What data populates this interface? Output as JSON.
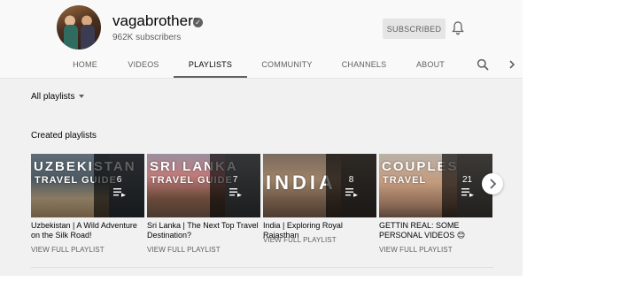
{
  "channel": {
    "name": "vagabrothers",
    "subscribers": "962K subscribers",
    "subscribe_label": "SUBSCRIBED"
  },
  "tabs": [
    {
      "label": "HOME"
    },
    {
      "label": "VIDEOS"
    },
    {
      "label": "PLAYLISTS"
    },
    {
      "label": "COMMUNITY"
    },
    {
      "label": "CHANNELS"
    },
    {
      "label": "ABOUT"
    }
  ],
  "active_tab": "PLAYLISTS",
  "sort": {
    "label": "All playlists"
  },
  "section": {
    "title": "Created playlists"
  },
  "playlists": [
    {
      "thumb_title": "UZBEKISTAN",
      "thumb_subtitle": "TRAVEL GUIDE",
      "count": "6",
      "title": "Uzbekistan | A Wild Adventure on the Silk Road!",
      "action": "VIEW FULL PLAYLIST"
    },
    {
      "thumb_title": "SRI LANKA",
      "thumb_subtitle": "TRAVEL GUIDE",
      "count": "7",
      "title": "Sri Lanka | The Next Top Travel Destination?",
      "action": "VIEW FULL PLAYLIST"
    },
    {
      "thumb_title": "INDIA",
      "thumb_subtitle": "",
      "count": "8",
      "title": "India | Exploring Royal Rajasthan",
      "action": "VIEW FULL PLAYLIST"
    },
    {
      "thumb_title": "COUPLES",
      "thumb_subtitle": "TRAVEL",
      "count": "21",
      "title": "GETTIN REAL: SOME PERSONAL VIDEOS 😊",
      "action": "VIEW FULL PLAYLIST"
    }
  ],
  "icons": {
    "verified": "verified-check-icon",
    "bell": "bell-icon",
    "search": "search-icon",
    "chevron": "chevron-right-icon",
    "playlist": "playlist-icon",
    "caret": "caret-down-icon"
  },
  "colors": {
    "text_primary": "#030303",
    "text_secondary": "#606060",
    "header_bg": "#f9f9f9",
    "content_bg": "#f1f1f1",
    "subscribed_bg": "#e5e5e5"
  }
}
